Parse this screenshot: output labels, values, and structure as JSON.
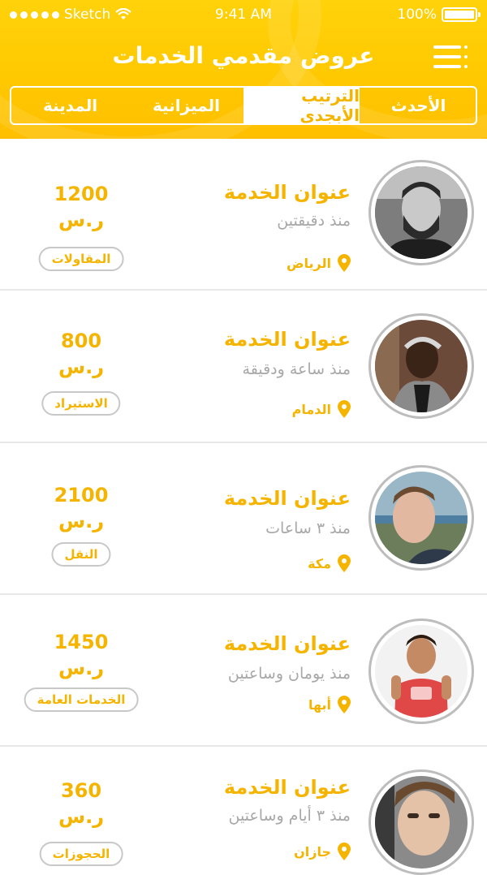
{
  "status_bar": {
    "carrier": "Sketch",
    "time": "9:41 AM",
    "battery": "100%"
  },
  "header": {
    "title": "عروض مقدمي الخدمات",
    "tabs": [
      {
        "label": "الأحدث",
        "active": false
      },
      {
        "label": "الترتيب الأبجدي",
        "active": true
      },
      {
        "label": "الميزانية",
        "active": false
      },
      {
        "label": "المدينة",
        "active": false
      }
    ]
  },
  "colors": {
    "accent": "#f5b400",
    "header_bg": "#ffc800",
    "muted_text": "#a8a8a8"
  },
  "offers": [
    {
      "title": "عنوان الخدمة",
      "time": "منذ دقيقتين",
      "city": "الرياض",
      "price": "1200",
      "currency": "ر.س",
      "category": "المقاولات"
    },
    {
      "title": "عنوان الخدمة",
      "time": "منذ ساعة ودقيقة",
      "city": "الدمام",
      "price": "800",
      "currency": "ر.س",
      "category": "الاستيراد"
    },
    {
      "title": "عنوان الخدمة",
      "time": "منذ ٣ ساعات",
      "city": "مكة",
      "price": "2100",
      "currency": "ر.س",
      "category": "النقل"
    },
    {
      "title": "عنوان الخدمة",
      "time": "منذ يومان وساعتين",
      "city": "أبها",
      "price": "1450",
      "currency": "ر.س",
      "category": "الخدمات العامة"
    },
    {
      "title": "عنوان الخدمة",
      "time": "منذ ٣ أيام وساعتين",
      "city": "جازان",
      "price": "360",
      "currency": "ر.س",
      "category": "الحجوزات"
    }
  ]
}
